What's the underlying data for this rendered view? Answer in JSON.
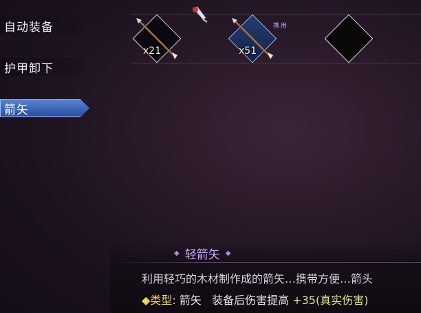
{
  "menu": {
    "items": [
      {
        "label": "自动装备",
        "active": false
      },
      {
        "label": "护甲卸下",
        "active": false
      },
      {
        "label": "箭矢",
        "active": true
      }
    ]
  },
  "slots": [
    {
      "count": "x21",
      "tag": "",
      "style": "dark",
      "icon": "arrow-icon"
    },
    {
      "count": "x51",
      "tag": "携用",
      "style": "blue",
      "icon": "arrow-icon"
    },
    {
      "count": "",
      "tag": "",
      "style": "dark",
      "icon": ""
    }
  ],
  "detail": {
    "name": "轻箭矢",
    "gem_left": "◆",
    "gem_right": "◆",
    "description": "利用轻巧的木材制作成的箭矢…携带方便…箭头",
    "type_label": "◆类型",
    "type_sep": ":",
    "type_value": "箭矢",
    "effect_text": "装备后伤害提高",
    "effect_value": "+35(真实伤害)"
  },
  "colors": {
    "accent_blue": "#3d64b4",
    "title_purple": "#c9a6ee",
    "stat_yellow": "#e8d36a"
  }
}
